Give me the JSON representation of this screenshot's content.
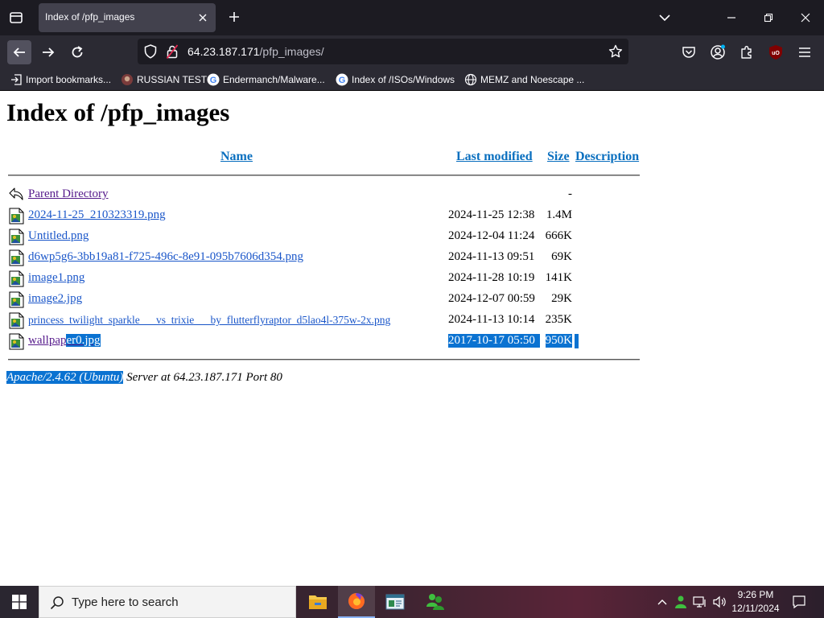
{
  "browser": {
    "tab": {
      "title": "Index of /pfp_images"
    },
    "url": {
      "host": "64.23.187.171",
      "path": "/pfp_images/"
    },
    "bookmarks": [
      {
        "label": "Import bookmarks...",
        "icon": "import-icon"
      },
      {
        "label": "RUSSIAN TEST",
        "icon": "site-favicon"
      },
      {
        "label": "Endermanch/Malware...",
        "icon": "google-icon"
      },
      {
        "label": "Index of /ISOs/Windows",
        "icon": "google-icon"
      },
      {
        "label": "MEMZ and Noescape ...",
        "icon": "globe-icon"
      }
    ]
  },
  "page": {
    "title": "Index of /pfp_images",
    "headers": {
      "name": "Name",
      "modified": "Last modified",
      "size": "Size",
      "description": "Description"
    },
    "parent": {
      "name": "Parent Directory",
      "size": "-"
    },
    "files": [
      {
        "name": "2024-11-25_210323319.png",
        "modified": "2024-11-25 12:38",
        "size": "1.4M"
      },
      {
        "name": "Untitled.png",
        "modified": "2024-12-04 11:24",
        "size": "666K"
      },
      {
        "name": "d6wp5g6-3bb19a81-f725-496c-8e91-095b7606d354.png",
        "modified": "2024-11-13 09:51",
        "size": "69K"
      },
      {
        "name": "image1.png",
        "modified": "2024-11-28 10:19",
        "size": "141K"
      },
      {
        "name": "image2.jpg",
        "modified": "2024-12-07 00:59",
        "size": "29K"
      },
      {
        "name": "princess_twilight_sparkle___vs_trixie___by_flutterflyraptor_d5lao4l-375w-2x.png",
        "modified": "2024-11-13 10:14",
        "size": "235K"
      },
      {
        "name_part1": "wallpap",
        "name_part2": "er0.jpg",
        "modified": "2017-10-17 05:50",
        "size": "950K"
      }
    ],
    "footer": {
      "software": "Apache/2.4.62 (Ubuntu)",
      "rest": " Server at 64.23.187.171 Port 80"
    }
  },
  "taskbar": {
    "search_placeholder": "Type here to search",
    "time": "9:26 PM",
    "date": "12/11/2024"
  },
  "colors": {
    "link": "#1a56c9",
    "visited": "#551a8b",
    "selection": "#0a72d1",
    "chrome_dark": "#1c1b22",
    "chrome": "#2b2a33"
  }
}
